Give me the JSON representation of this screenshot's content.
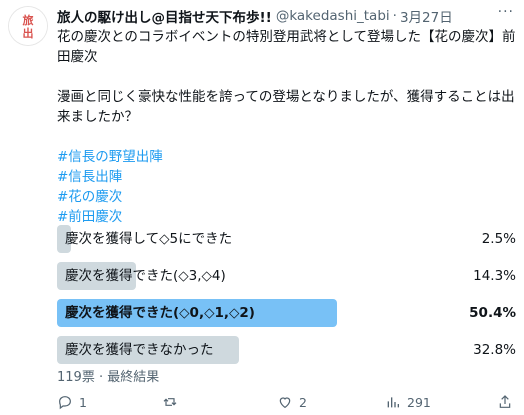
{
  "tweet": {
    "author_name": "旅人の駆け出し@目指せ天下布歩!!",
    "handle": "@kakedashi_tabi",
    "separator": "·",
    "date": "3月27日",
    "more_label": "···",
    "avatar_text": "旅\n出",
    "text_line1": "花の慶次とのコラボイベントの特別登用武将として登場した【花の慶次】前",
    "text_line2": "田慶次",
    "text_line3": "漫画と同じく豪快な性能を誇っての登場となりましたが、獲得することは出",
    "text_line4": "来ましたか？",
    "hashtags": [
      "#信長の野望出陣",
      "#信長出陣",
      "#花の慶次",
      "#前田慶次"
    ]
  },
  "poll": {
    "options": [
      {
        "label": "慶次を獲得して◇5にできた",
        "percent_text": "2.5%",
        "percent": 2.5,
        "winner": false
      },
      {
        "label": "慶次を獲得できた(◇3,◇4)",
        "percent_text": "14.3%",
        "percent": 14.3,
        "winner": false
      },
      {
        "label": "慶次を獲得できた(◇0,◇1,◇2)",
        "percent_text": "50.4%",
        "percent": 50.4,
        "winner": true
      },
      {
        "label": "慶次を獲得できなかった",
        "percent_text": "32.8%",
        "percent": 32.8,
        "winner": false
      }
    ],
    "summary": "119票 · 最終結果"
  },
  "actions": {
    "replies": "1",
    "retweets": "",
    "likes": "2",
    "views": "291"
  },
  "colors": {
    "accent": "#1d9bf0",
    "winner_bar": "#78c1f6",
    "bar": "#cfd9de",
    "muted": "#536471"
  }
}
